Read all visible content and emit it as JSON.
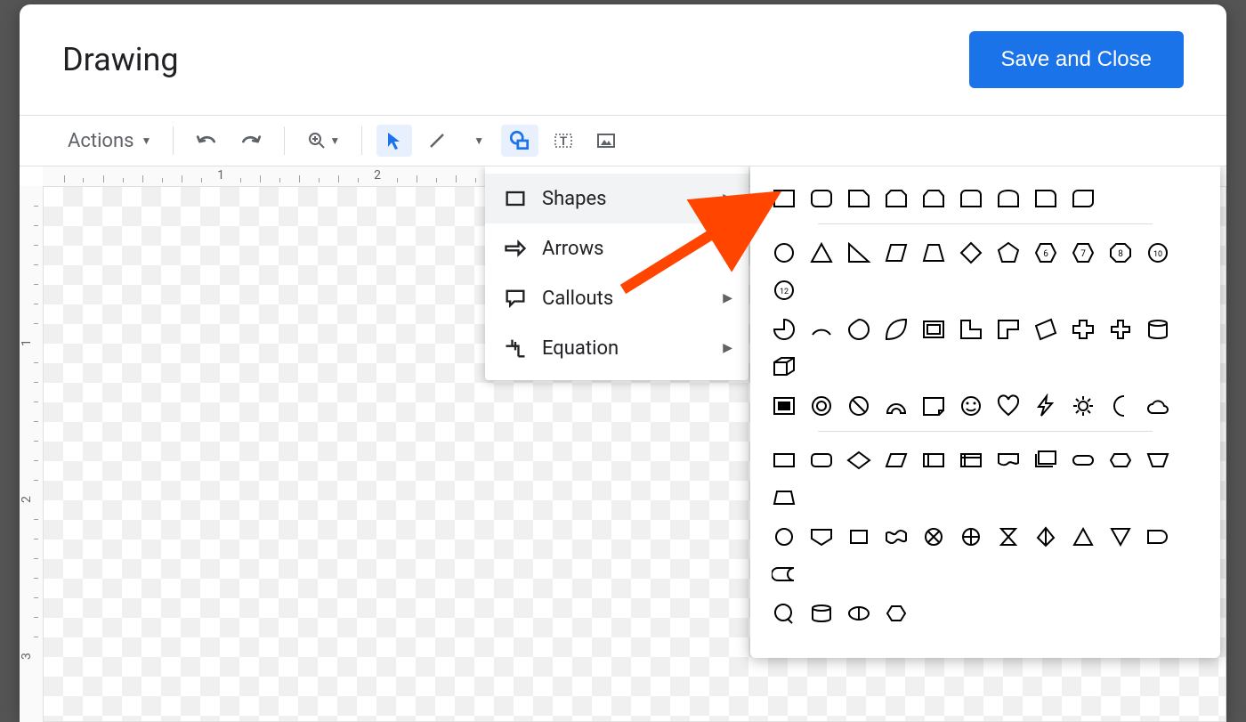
{
  "dialog": {
    "title": "Drawing",
    "save_label": "Save and Close"
  },
  "toolbar": {
    "actions_label": "Actions"
  },
  "menu": {
    "items": [
      {
        "icon": "rectangle-icon",
        "label": "Shapes",
        "has_submenu": true,
        "highlighted": true
      },
      {
        "icon": "arrow-right-icon",
        "label": "Arrows",
        "has_submenu": true,
        "highlighted": false
      },
      {
        "icon": "callout-icon",
        "label": "Callouts",
        "has_submenu": true,
        "highlighted": false
      },
      {
        "icon": "equation-icon",
        "label": "Equation",
        "has_submenu": true,
        "highlighted": false
      }
    ]
  },
  "ruler": {
    "h1": "1",
    "h2": "2",
    "v1": "1",
    "v2": "2",
    "v3": "3"
  },
  "shapes_panel": {
    "group1": [
      "rect",
      "round-rect",
      "snip1",
      "snip2",
      "snip-top",
      "round-top",
      "half-round",
      "round1",
      "round-diag"
    ],
    "group2_row1": [
      "circle",
      "triangle",
      "rtriangle",
      "parallelogram",
      "trapezoid",
      "diamond",
      "pentagon",
      "hex6",
      "hex7",
      "hex8",
      "hex10",
      "hex12"
    ],
    "group2_row2": [
      "pie",
      "arc",
      "teardrop",
      "leaf",
      "frame",
      "l-shape",
      "corner",
      "stripe",
      "cross",
      "plus",
      "cylinder",
      "cube"
    ],
    "group2_row3": [
      "bevel-frame",
      "donut",
      "no-symbol",
      "block-arc",
      "folded",
      "smiley",
      "heart",
      "lightning",
      "sun",
      "moon",
      "cloud"
    ],
    "group3_row1": [
      "flow-rect",
      "flow-round",
      "flow-diamond",
      "flow-para",
      "flow-docs",
      "flow-multidoc",
      "flow-display",
      "flow-stack",
      "flow-pill",
      "flow-hexflat",
      "flow-trapflat",
      "flow-manual"
    ],
    "group3_row2": [
      "flow-circle",
      "flow-shield",
      "flow-box",
      "flow-wave",
      "flow-sum",
      "flow-or",
      "flow-hourglass",
      "flow-merge",
      "flow-triup",
      "flow-tridown",
      "flow-delay",
      "flow-stored"
    ],
    "group3_row3": [
      "flow-callout-circle",
      "flow-drum",
      "flow-lens",
      "flow-hex"
    ]
  }
}
